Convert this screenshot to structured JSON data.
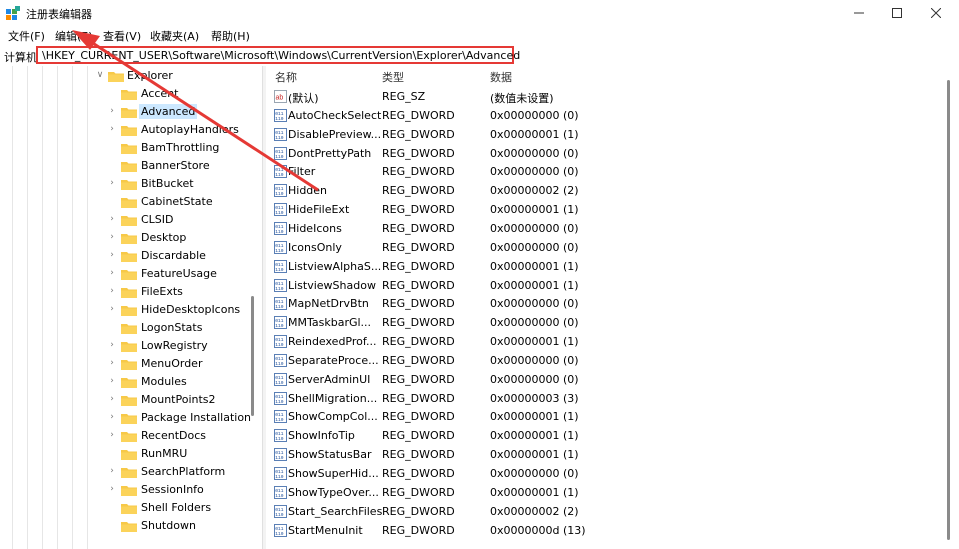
{
  "window": {
    "title": "注册表编辑器",
    "accent_color": "#e53935"
  },
  "menu": [
    "文件(F)",
    "编辑(E)",
    "查看(V)",
    "收藏夹(A)",
    "帮助(H)"
  ],
  "address": {
    "label": "计算机",
    "path": "\\HKEY_CURRENT_USER\\Software\\Microsoft\\Windows\\CurrentVersion\\Explorer\\Advanced"
  },
  "tree": {
    "items": [
      {
        "label": "Explorer",
        "expandable": true,
        "expanded": true
      },
      {
        "label": "Accent",
        "expandable": false
      },
      {
        "label": "Advanced",
        "expandable": true,
        "selected": true
      },
      {
        "label": "AutoplayHandlers",
        "expandable": true
      },
      {
        "label": "BamThrottling",
        "expandable": false
      },
      {
        "label": "BannerStore",
        "expandable": false
      },
      {
        "label": "BitBucket",
        "expandable": true
      },
      {
        "label": "CabinetState",
        "expandable": false
      },
      {
        "label": "CLSID",
        "expandable": true
      },
      {
        "label": "Desktop",
        "expandable": true
      },
      {
        "label": "Discardable",
        "expandable": true
      },
      {
        "label": "FeatureUsage",
        "expandable": true
      },
      {
        "label": "FileExts",
        "expandable": true
      },
      {
        "label": "HideDesktopIcons",
        "expandable": true
      },
      {
        "label": "LogonStats",
        "expandable": false
      },
      {
        "label": "LowRegistry",
        "expandable": true
      },
      {
        "label": "MenuOrder",
        "expandable": true
      },
      {
        "label": "Modules",
        "expandable": true
      },
      {
        "label": "MountPoints2",
        "expandable": true
      },
      {
        "label": "Package Installation",
        "expandable": true
      },
      {
        "label": "RecentDocs",
        "expandable": true
      },
      {
        "label": "RunMRU",
        "expandable": false
      },
      {
        "label": "SearchPlatform",
        "expandable": true
      },
      {
        "label": "SessionInfo",
        "expandable": true
      },
      {
        "label": "Shell Folders",
        "expandable": false
      },
      {
        "label": "Shutdown",
        "expandable": false
      }
    ]
  },
  "list": {
    "columns": [
      "名称",
      "类型",
      "数据"
    ],
    "rows": [
      {
        "name": "(默认)",
        "type": "REG_SZ",
        "data": "(数值未设置)",
        "icon": "string-value-icon"
      },
      {
        "name": "AutoCheckSelect",
        "type": "REG_DWORD",
        "data": "0x00000000 (0)",
        "icon": "binary-value-icon"
      },
      {
        "name": "DisablePreview...",
        "type": "REG_DWORD",
        "data": "0x00000001 (1)",
        "icon": "binary-value-icon"
      },
      {
        "name": "DontPrettyPath",
        "type": "REG_DWORD",
        "data": "0x00000000 (0)",
        "icon": "binary-value-icon"
      },
      {
        "name": "Filter",
        "type": "REG_DWORD",
        "data": "0x00000000 (0)",
        "icon": "binary-value-icon"
      },
      {
        "name": "Hidden",
        "type": "REG_DWORD",
        "data": "0x00000002 (2)",
        "icon": "binary-value-icon"
      },
      {
        "name": "HideFileExt",
        "type": "REG_DWORD",
        "data": "0x00000001 (1)",
        "icon": "binary-value-icon"
      },
      {
        "name": "HideIcons",
        "type": "REG_DWORD",
        "data": "0x00000000 (0)",
        "icon": "binary-value-icon"
      },
      {
        "name": "IconsOnly",
        "type": "REG_DWORD",
        "data": "0x00000000 (0)",
        "icon": "binary-value-icon"
      },
      {
        "name": "ListviewAlphaS...",
        "type": "REG_DWORD",
        "data": "0x00000001 (1)",
        "icon": "binary-value-icon"
      },
      {
        "name": "ListviewShadow",
        "type": "REG_DWORD",
        "data": "0x00000001 (1)",
        "icon": "binary-value-icon"
      },
      {
        "name": "MapNetDrvBtn",
        "type": "REG_DWORD",
        "data": "0x00000000 (0)",
        "icon": "binary-value-icon"
      },
      {
        "name": "MMTaskbarGl...",
        "type": "REG_DWORD",
        "data": "0x00000000 (0)",
        "icon": "binary-value-icon"
      },
      {
        "name": "ReindexedProf...",
        "type": "REG_DWORD",
        "data": "0x00000001 (1)",
        "icon": "binary-value-icon"
      },
      {
        "name": "SeparateProce...",
        "type": "REG_DWORD",
        "data": "0x00000000 (0)",
        "icon": "binary-value-icon"
      },
      {
        "name": "ServerAdminUI",
        "type": "REG_DWORD",
        "data": "0x00000000 (0)",
        "icon": "binary-value-icon"
      },
      {
        "name": "ShellMigration...",
        "type": "REG_DWORD",
        "data": "0x00000003 (3)",
        "icon": "binary-value-icon"
      },
      {
        "name": "ShowCompCol...",
        "type": "REG_DWORD",
        "data": "0x00000001 (1)",
        "icon": "binary-value-icon"
      },
      {
        "name": "ShowInfoTip",
        "type": "REG_DWORD",
        "data": "0x00000001 (1)",
        "icon": "binary-value-icon"
      },
      {
        "name": "ShowStatusBar",
        "type": "REG_DWORD",
        "data": "0x00000001 (1)",
        "icon": "binary-value-icon"
      },
      {
        "name": "ShowSuperHid...",
        "type": "REG_DWORD",
        "data": "0x00000000 (0)",
        "icon": "binary-value-icon"
      },
      {
        "name": "ShowTypeOver...",
        "type": "REG_DWORD",
        "data": "0x00000001 (1)",
        "icon": "binary-value-icon"
      },
      {
        "name": "Start_SearchFiles",
        "type": "REG_DWORD",
        "data": "0x00000002 (2)",
        "icon": "binary-value-icon"
      },
      {
        "name": "StartMenuInit",
        "type": "REG_DWORD",
        "data": "0x0000000d (13)",
        "icon": "binary-value-icon"
      }
    ]
  }
}
